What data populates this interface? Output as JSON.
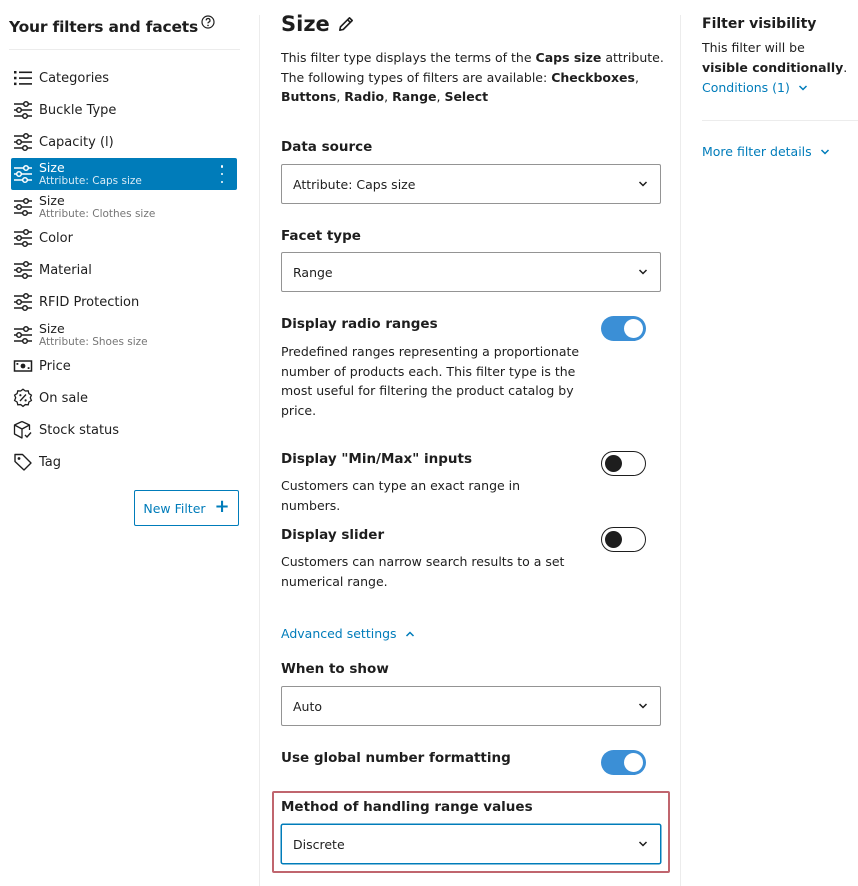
{
  "sidebar": {
    "title": "Your filters and facets",
    "items": [
      {
        "label": "Categories",
        "icon": "list-icon"
      },
      {
        "label": "Buckle Type",
        "icon": "sliders-icon"
      },
      {
        "label": "Capacity (l)",
        "icon": "sliders-icon"
      },
      {
        "label": "Size",
        "sub": "Attribute: Caps size",
        "icon": "sliders-icon",
        "active": true
      },
      {
        "label": "Size",
        "sub": "Attribute: Clothes size",
        "icon": "sliders-icon"
      },
      {
        "label": "Color",
        "icon": "sliders-icon"
      },
      {
        "label": "Material",
        "icon": "sliders-icon"
      },
      {
        "label": "RFID Protection",
        "icon": "sliders-icon"
      },
      {
        "label": "Size",
        "sub": "Attribute: Shoes size",
        "icon": "sliders-icon"
      },
      {
        "label": "Price",
        "icon": "money-icon"
      },
      {
        "label": "On sale",
        "icon": "percent-badge-icon"
      },
      {
        "label": "Stock status",
        "icon": "box-check-icon"
      },
      {
        "label": "Tag",
        "icon": "tag-icon"
      }
    ],
    "new_filter_label": "New Filter"
  },
  "main": {
    "title": "Size",
    "desc": {
      "p1": "This filter type displays the terms of the ",
      "attr": "Caps size",
      "p2": " attribute. The following types of filters are available: ",
      "t1": "Checkboxes",
      "sep1": ", ",
      "t2": "Buttons",
      "sep2": ", ",
      "t3": "Radio",
      "sep3": ", ",
      "t4": "Range",
      "sep4": ", ",
      "t5": "Select"
    },
    "data_source": {
      "label": "Data source",
      "value": "Attribute: Caps size"
    },
    "facet_type": {
      "label": "Facet type",
      "value": "Range"
    },
    "display_radio_ranges": {
      "label": "Display radio ranges",
      "help": "Predefined ranges representing a proportionate number of products each. This filter type is the most useful for filtering the product catalog by price.",
      "enabled": true
    },
    "display_minmax": {
      "label": "Display \"Min/Max\" inputs",
      "help": "Customers can type an exact range in numbers.",
      "enabled": false
    },
    "display_slider": {
      "label": "Display slider",
      "help": "Customers can narrow search results to a set numerical range.",
      "enabled": false
    },
    "advanced_settings_label": "Advanced settings",
    "when_to_show": {
      "label": "When to show",
      "value": "Auto"
    },
    "global_number_formatting": {
      "label": "Use global number formatting",
      "enabled": true
    },
    "range_method": {
      "label": "Method of handling range values",
      "value": "Discrete"
    }
  },
  "right": {
    "title": "Filter visibility",
    "desc_1": "This filter will be ",
    "desc_bold": "visible conditionally",
    "desc_2": ".",
    "conditions_label": "Conditions (1)",
    "more_details_label": "More filter details"
  },
  "colors": {
    "accent": "#007cba",
    "toggle_on": "#3b8fd6",
    "highlight": "#c0656e"
  }
}
